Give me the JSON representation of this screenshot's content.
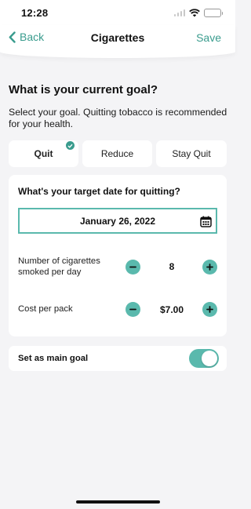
{
  "status_bar": {
    "time": "12:28"
  },
  "nav": {
    "back_label": "Back",
    "title": "Cigarettes",
    "save_label": "Save"
  },
  "goal": {
    "heading": "What is your current goal?",
    "description": "Select your goal. Quitting tobacco is recommended for your health.",
    "tabs": [
      {
        "label": "Quit",
        "selected": true
      },
      {
        "label": "Reduce",
        "selected": false
      },
      {
        "label": "Stay Quit",
        "selected": false
      }
    ]
  },
  "target": {
    "question": "What's your target date for quitting?",
    "date": "January 26, 2022",
    "cigarettes": {
      "label": "Number of cigarettes smoked per day",
      "value": "8"
    },
    "cost": {
      "label": "Cost per pack",
      "value": "$7.00"
    }
  },
  "main_goal": {
    "label": "Set as main goal",
    "enabled": true
  },
  "colors": {
    "accent": "#3a9c8e",
    "accent_light": "#5ab9ad",
    "background": "#f4f4f6",
    "card": "#ffffff"
  },
  "icons": {
    "back": "chevron-left-icon",
    "calendar": "calendar-icon",
    "minus": "minus-icon",
    "plus": "plus-icon",
    "check": "check-icon"
  }
}
